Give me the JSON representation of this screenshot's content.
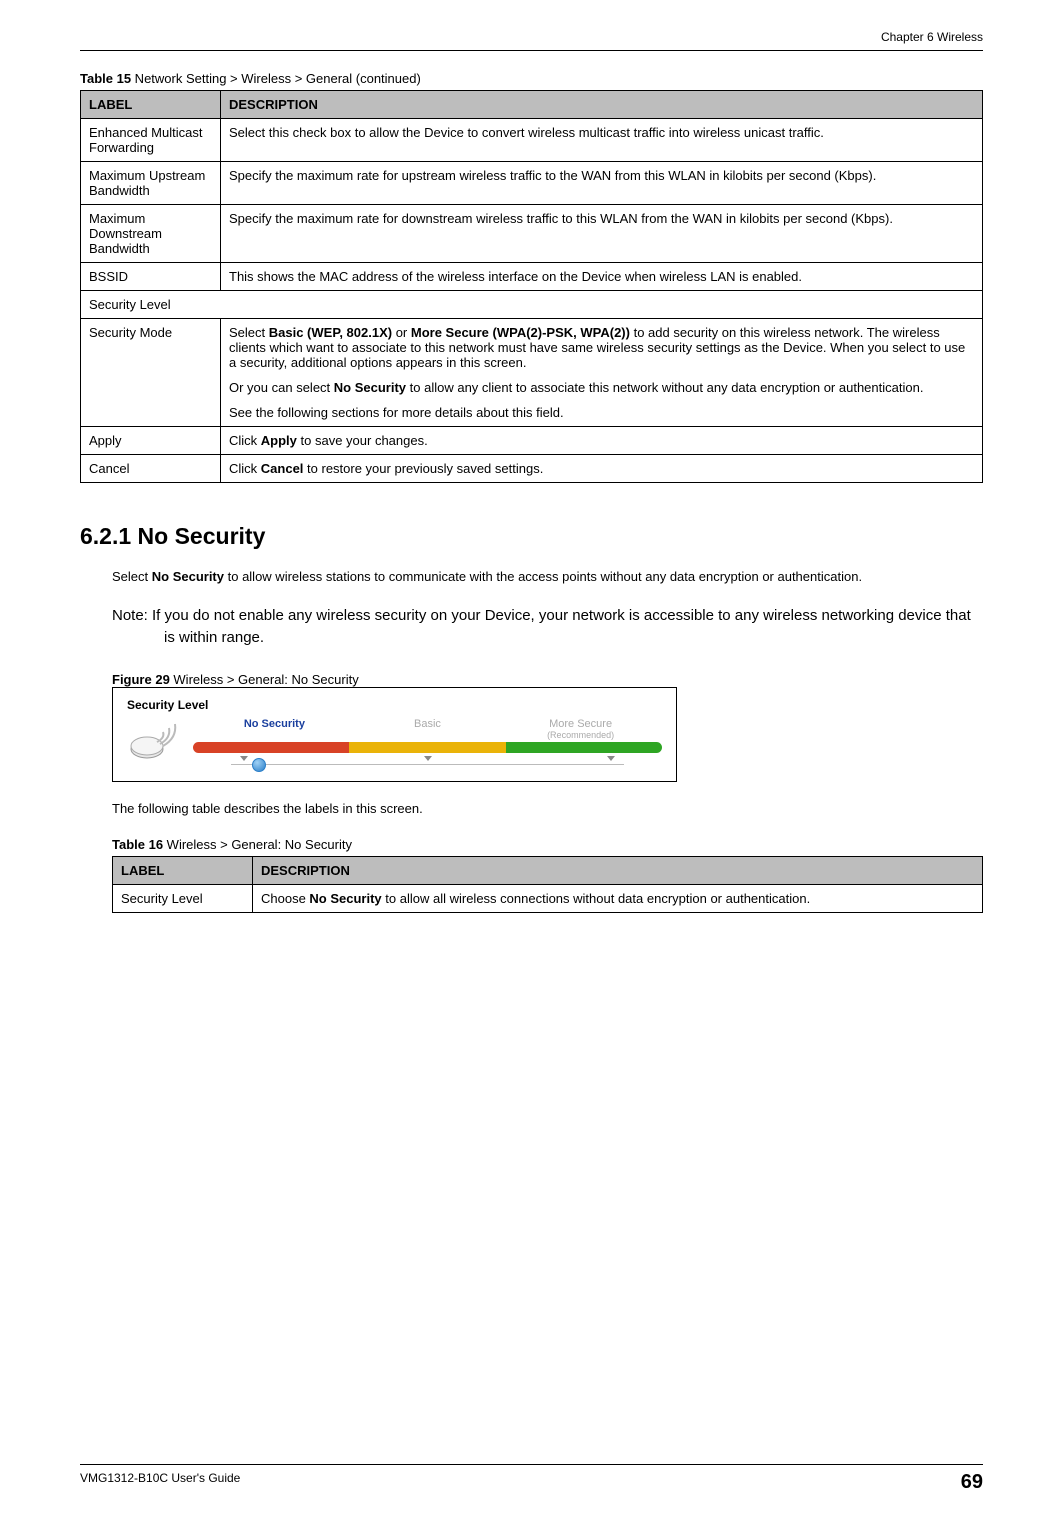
{
  "chapter_header": "Chapter 6 Wireless",
  "table15": {
    "caption_bold": "Table 15",
    "caption_rest": "   Network Setting > Wireless > General (continued)",
    "headers": {
      "label": "LABEL",
      "description": "DESCRIPTION"
    },
    "rows": {
      "enhanced_multicast": {
        "label": "Enhanced Multicast Forwarding",
        "desc": "Select this check box to allow the Device to convert wireless multicast traffic into wireless unicast traffic."
      },
      "max_upstream": {
        "label": "Maximum Upstream Bandwidth",
        "desc": "Specify the maximum rate for upstream wireless traffic to the WAN from this WLAN in kilobits per second (Kbps)."
      },
      "max_downstream": {
        "label": "Maximum Downstream Bandwidth",
        "desc": "Specify the maximum rate for downstream wireless traffic to this WLAN from the WAN in kilobits per second (Kbps)."
      },
      "bssid": {
        "label": "BSSID",
        "desc": "This shows the MAC address of the wireless interface on the Device when wireless LAN is enabled."
      },
      "security_level": "Security Level",
      "security_mode": {
        "label": "Security Mode",
        "p1_a": "Select ",
        "p1_bold1": "Basic (WEP, 802.1X)",
        "p1_b": " or ",
        "p1_bold2": "More Secure (WPA(2)-PSK, WPA(2))",
        "p1_c": " to add security on this wireless network. The wireless clients which want to associate to this network must have same wireless security settings as the Device. When you select to use a security, additional options appears in this screen.",
        "p2_a": "Or you can select ",
        "p2_bold": "No Security",
        "p2_b": " to allow any client to associate this network without any data encryption or authentication.",
        "p3": "See the following sections for more details about this field."
      },
      "apply": {
        "label": "Apply",
        "desc_a": "Click ",
        "desc_bold": "Apply",
        "desc_b": " to save your changes."
      },
      "cancel": {
        "label": "Cancel",
        "desc_a": "Click ",
        "desc_bold": "Cancel",
        "desc_b": " to restore your previously saved settings."
      }
    }
  },
  "section_heading": "6.2.1  No Security",
  "body1_a": "Select ",
  "body1_bold": "No Security",
  "body1_b": " to allow wireless stations to communicate with the access points without any data encryption or authentication.",
  "note_text": "Note: If you do not enable any wireless security on your Device, your network is accessible to any wireless networking device that is within range.",
  "figure29": {
    "caption_bold": "Figure 29",
    "caption_rest": "   Wireless > General: No Security",
    "sec_level_label": "Security Level",
    "labels": {
      "no_security": "No Security",
      "basic": "Basic",
      "more_secure": "More Secure",
      "recommended": "(Recommended)"
    }
  },
  "body2": "The following table describes the labels in this screen.",
  "table16": {
    "caption_bold": "Table 16",
    "caption_rest": "   Wireless > General: No Security",
    "headers": {
      "label": "LABEL",
      "description": "DESCRIPTION"
    },
    "row": {
      "label": "Security Level",
      "desc_a": "Choose ",
      "desc_bold": "No Security",
      "desc_b": " to allow all wireless connections without data encryption or authentication."
    }
  },
  "footer": {
    "guide": "VMG1312-B10C User's Guide",
    "page": "69"
  }
}
